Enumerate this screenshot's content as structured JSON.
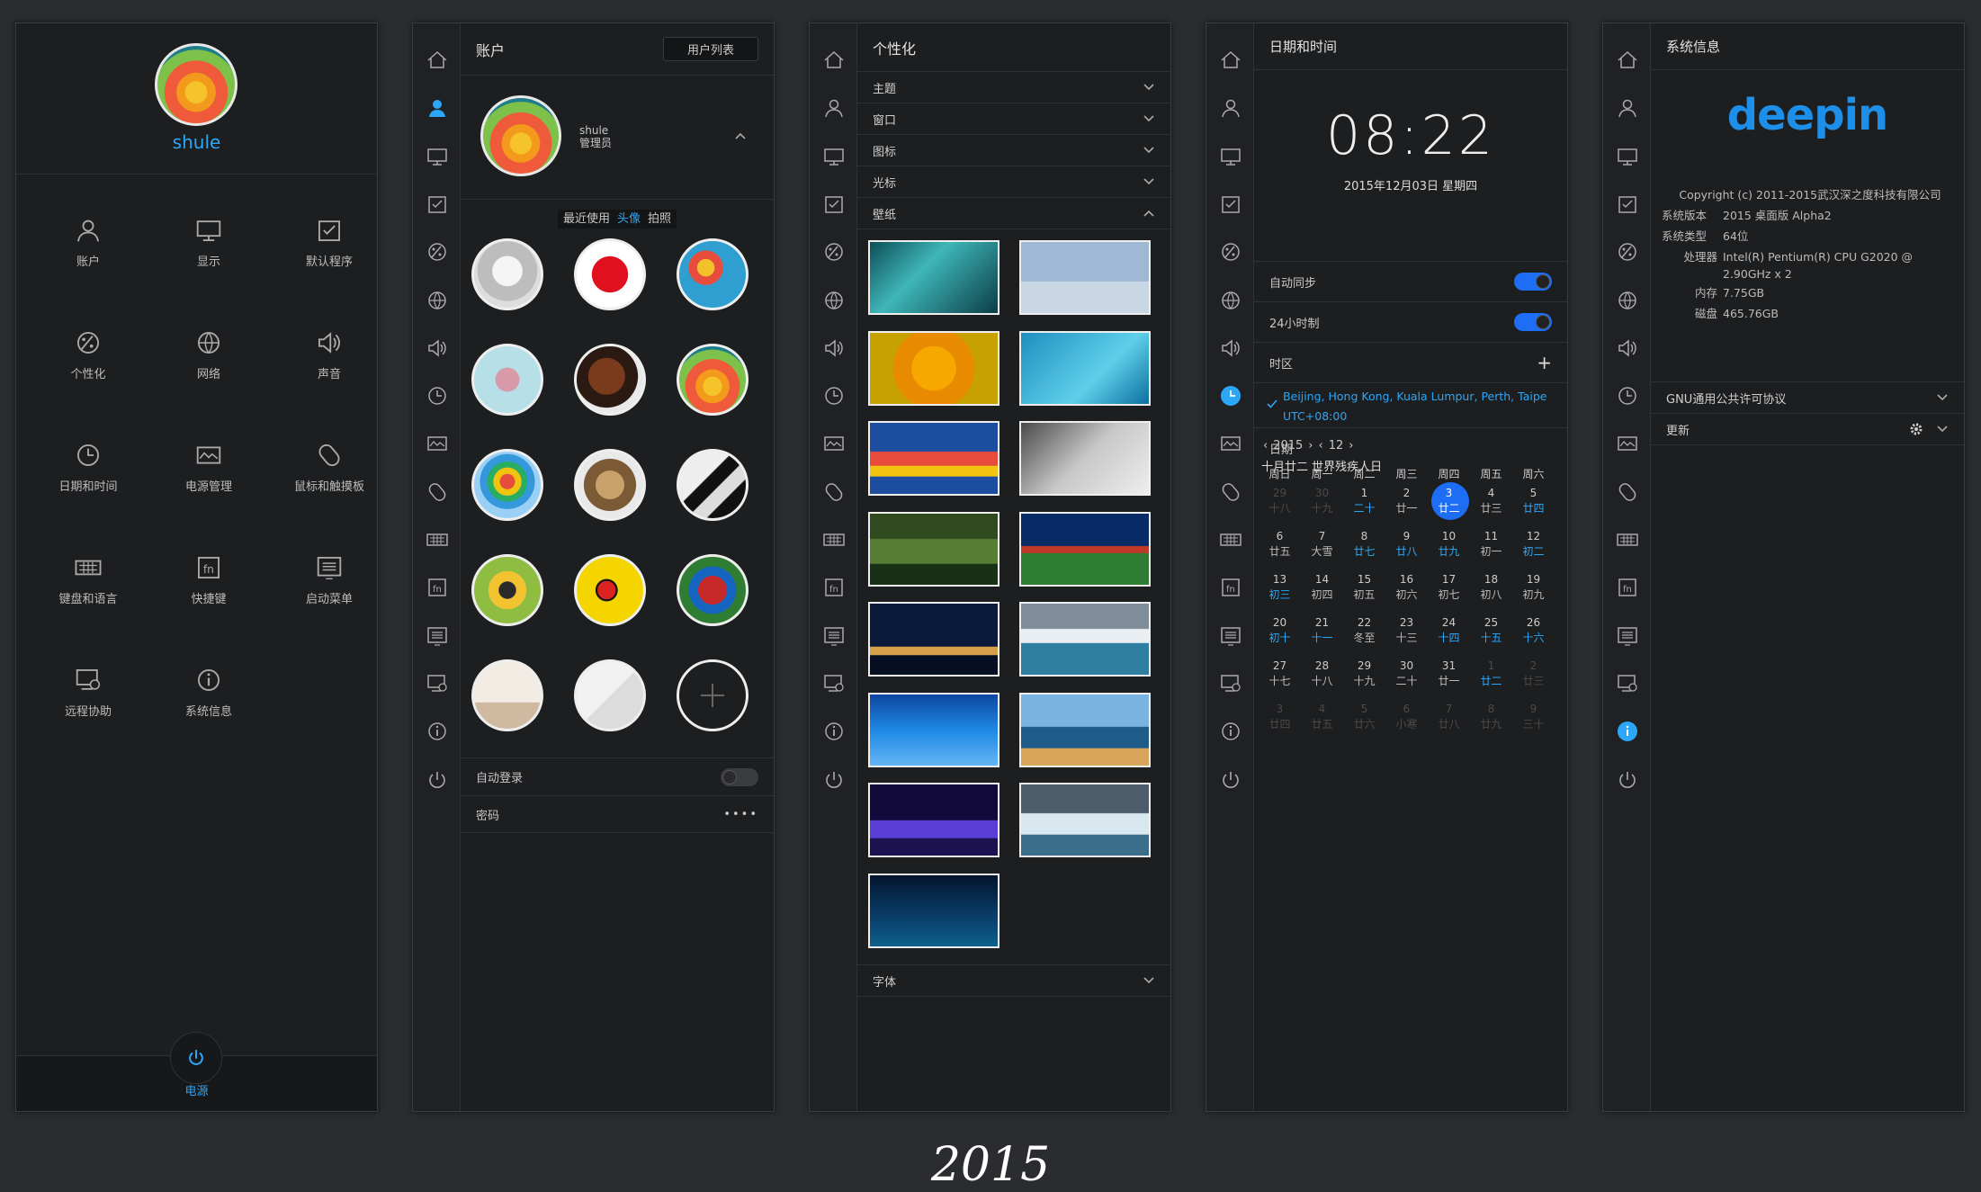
{
  "colors": {
    "accent": "#2ca7f8",
    "toggle_on": "#1d6ef5",
    "panel_bg": "#1d1e20",
    "page_bg": "#2a2c2f"
  },
  "home": {
    "username": "shule",
    "tiles": [
      {
        "label": "账户",
        "icon": "user-icon"
      },
      {
        "label": "显示",
        "icon": "display-icon"
      },
      {
        "label": "默认程序",
        "icon": "default-apps-icon"
      },
      {
        "label": "个性化",
        "icon": "personalization-icon"
      },
      {
        "label": "网络",
        "icon": "network-icon"
      },
      {
        "label": "声音",
        "icon": "sound-icon"
      },
      {
        "label": "日期和时间",
        "icon": "clock-icon"
      },
      {
        "label": "电源管理",
        "icon": "power-management-icon"
      },
      {
        "label": "鼠标和触摸板",
        "icon": "mouse-icon"
      },
      {
        "label": "键盘和语言",
        "icon": "keyboard-icon"
      },
      {
        "label": "快捷键",
        "icon": "shortcut-icon"
      },
      {
        "label": "启动菜单",
        "icon": "boot-menu-icon"
      },
      {
        "label": "远程协助",
        "icon": "remote-assist-icon"
      },
      {
        "label": "系统信息",
        "icon": "info-icon"
      }
    ],
    "power_label": "电源"
  },
  "accounts": {
    "title": "账户",
    "user_list_button": "用户列表",
    "user_name": "shule",
    "user_role": "管理员",
    "tabs": [
      "最近使用",
      "头像",
      "拍照"
    ],
    "auto_login_label": "自动登录",
    "password_label": "密码",
    "password_mask": "••••"
  },
  "personalization": {
    "title": "个性化",
    "sections": [
      "主题",
      "窗口",
      "图标",
      "光标",
      "壁纸"
    ],
    "font_section": "字体"
  },
  "datetime": {
    "title": "日期和时间",
    "time": "08:22",
    "date": "2015年12月03日 星期四",
    "auto_sync_label": "自动同步",
    "hour24_label": "24小时制",
    "timezone_label": "时区",
    "timezone_name": "Beijing, Hong Kong, Kuala Lumpur, Perth, Taipe",
    "timezone_offset": "UTC+08:00",
    "date_label": "日期",
    "cal_year": "2015",
    "cal_month": "12",
    "lunar_info": "十月廿二 世界残疾人日",
    "weekdays": [
      "周日",
      "周一",
      "周二",
      "周三",
      "周四",
      "周五",
      "周六"
    ],
    "weeks": [
      [
        [
          "29",
          "十八",
          1,
          0
        ],
        [
          "30",
          "十九",
          1,
          0
        ],
        [
          "1",
          "二十",
          0,
          1
        ],
        [
          "2",
          "廿一",
          0,
          0
        ],
        [
          "3",
          "廿二",
          0,
          0
        ],
        [
          "4",
          "廿三",
          0,
          0
        ],
        [
          "5",
          "廿四",
          0,
          1
        ]
      ],
      [
        [
          "6",
          "廿五",
          0,
          0
        ],
        [
          "7",
          "大雪",
          0,
          0
        ],
        [
          "8",
          "廿七",
          0,
          1
        ],
        [
          "9",
          "廿八",
          0,
          1
        ],
        [
          "10",
          "廿九",
          0,
          1
        ],
        [
          "11",
          "初一",
          0,
          0
        ],
        [
          "12",
          "初二",
          0,
          1
        ]
      ],
      [
        [
          "13",
          "初三",
          0,
          1
        ],
        [
          "14",
          "初四",
          0,
          0
        ],
        [
          "15",
          "初五",
          0,
          0
        ],
        [
          "16",
          "初六",
          0,
          0
        ],
        [
          "17",
          "初七",
          0,
          0
        ],
        [
          "18",
          "初八",
          0,
          0
        ],
        [
          "19",
          "初九",
          0,
          0
        ]
      ],
      [
        [
          "20",
          "初十",
          0,
          1
        ],
        [
          "21",
          "十一",
          0,
          1
        ],
        [
          "22",
          "冬至",
          0,
          0
        ],
        [
          "23",
          "十三",
          0,
          0
        ],
        [
          "24",
          "十四",
          0,
          1
        ],
        [
          "25",
          "十五",
          0,
          1
        ],
        [
          "26",
          "十六",
          0,
          1
        ]
      ],
      [
        [
          "27",
          "十七",
          0,
          0
        ],
        [
          "28",
          "十八",
          0,
          0
        ],
        [
          "29",
          "十九",
          0,
          0
        ],
        [
          "30",
          "二十",
          0,
          0
        ],
        [
          "31",
          "廿一",
          0,
          0
        ],
        [
          "1",
          "廿二",
          1,
          1
        ],
        [
          "2",
          "廿三",
          1,
          0
        ]
      ],
      [
        [
          "3",
          "廿四",
          1,
          0
        ],
        [
          "4",
          "廿五",
          1,
          0
        ],
        [
          "5",
          "廿六",
          1,
          0
        ],
        [
          "6",
          "小寒",
          1,
          0
        ],
        [
          "7",
          "廿八",
          1,
          0
        ],
        [
          "8",
          "廿九",
          1,
          0
        ],
        [
          "9",
          "三十",
          1,
          0
        ]
      ]
    ]
  },
  "sysinfo": {
    "title": "系统信息",
    "logo": "deepin",
    "copyright": "Copyright (c) 2011-2015武汉深之度科技有限公司",
    "version_label": "系统版本",
    "version_value": "2015 桌面版 Alpha2",
    "type_label": "系统类型",
    "type_value": "64位",
    "cpu_label": "处理器",
    "cpu_value_1": "Intel(R) Pentium(R) CPU G2020 @",
    "cpu_value_2": "2.90GHz x 2",
    "mem_label": "内存",
    "mem_value": "7.75GB",
    "disk_label": "磁盘",
    "disk_value": "465.76GB",
    "license_label": "GNU通用公共许可协议",
    "update_label": "更新"
  },
  "caption": "2015"
}
